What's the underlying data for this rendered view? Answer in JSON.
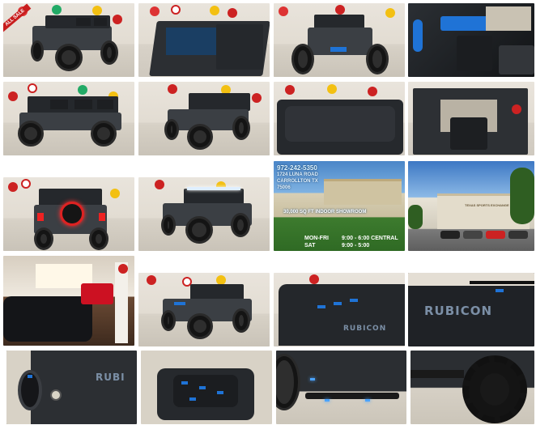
{
  "gallery": {
    "tiles": [
      {
        "name": "photo-1",
        "alt": "Jeep front quarter view with sale ribbon"
      },
      {
        "name": "photo-2",
        "alt": "Jeep top open roof view"
      },
      {
        "name": "photo-3",
        "alt": "Jeep front view with winch"
      },
      {
        "name": "photo-4",
        "alt": "Jeep interior dashboard blue accents"
      },
      {
        "name": "photo-5",
        "alt": "Jeep side profile"
      },
      {
        "name": "photo-6",
        "alt": "Jeep front quarter view low angle"
      },
      {
        "name": "photo-7",
        "alt": "Jeep hard top roof"
      },
      {
        "name": "photo-8",
        "alt": "Jeep rear interior open"
      },
      {
        "name": "photo-9",
        "alt": "Jeep rear with lit spare tire"
      },
      {
        "name": "photo-10",
        "alt": "Jeep front with light bar"
      },
      {
        "name": "photo-11",
        "alt": "Dealership showroom info card"
      },
      {
        "name": "photo-12",
        "alt": "Dealership exterior"
      },
      {
        "name": "photo-13",
        "alt": "Showroom interior"
      },
      {
        "name": "photo-14",
        "alt": "Jeep front quarter in showroom"
      },
      {
        "name": "photo-15",
        "alt": "Hood close-up with Rubicon decal"
      },
      {
        "name": "photo-16",
        "alt": "Rubicon hood decal close-up"
      },
      {
        "name": "photo-17",
        "alt": "Fuel door close-up"
      },
      {
        "name": "photo-18",
        "alt": "Hood vents close-up"
      },
      {
        "name": "photo-19",
        "alt": "Running boards with lights"
      },
      {
        "name": "photo-20",
        "alt": "Rear tire close-up"
      }
    ],
    "sale_badge": "ALL SALE",
    "rubicon_label": "RUBICON",
    "rubicon_label_small": "RUBI",
    "dealer": {
      "phone": "972-242-5350",
      "street": "1724 LUNA ROAD",
      "city": "CARROLLTON TX",
      "zip": "75006",
      "showroom": "30,000 SQ FT INDOOR SHOWROOM",
      "weekday_label": "MON-FRI",
      "weekday_hours": "9:00 - 6:00 CENTRAL",
      "sat_label": "SAT",
      "sat_hours": "9:00 - 5:00",
      "sign": "TEXAS SPORTS EXCHANGE"
    }
  }
}
